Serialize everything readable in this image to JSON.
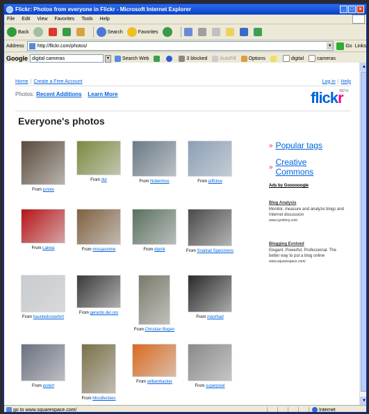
{
  "window": {
    "title": "Flickr: Photos from everyone in Flickr - Microsoft Internet Explorer",
    "controls": [
      "_",
      "□",
      "×"
    ]
  },
  "menu": [
    "File",
    "Edit",
    "View",
    "Favorites",
    "Tools",
    "Help"
  ],
  "toolbar": {
    "back": "Back",
    "search": "Search",
    "favorites": "Favorites"
  },
  "address": {
    "label": "Address",
    "url": "http://flickr.com/photos/",
    "go": "Go",
    "links": "Links"
  },
  "google_toolbar": {
    "logo": "Google",
    "query": "digital cameras",
    "search_web": "Search Web",
    "blocked": "3 blocked",
    "autofill": "AutoFill",
    "options": "Options",
    "term1": "digital",
    "term2": "cameras"
  },
  "page": {
    "nav": {
      "home": "Home",
      "create": "Create a Free Account",
      "login": "Log in",
      "help": "Help",
      "sep": "|"
    },
    "photos_label": "Photos:",
    "recent": "Recent Additions",
    "dot": "·",
    "learn": "Learn More",
    "logo_fl": "flick",
    "logo_r": "r",
    "beta": "BETA",
    "heading": "Everyone's photos",
    "from": "From",
    "photos": [
      {
        "user": "junnie",
        "color": "#5a4a3a",
        "w": 64,
        "h": 64
      },
      {
        "user": "dvt",
        "color": "#7a8a3e",
        "w": 64,
        "h": 50
      },
      {
        "user": "Nobermus",
        "color": "#6a7a86",
        "w": 64,
        "h": 52
      },
      {
        "user": "jeffclow",
        "color": "#8aa0b8",
        "w": 64,
        "h": 52
      },
      {
        "user": "Lakwa",
        "color": "#b81418",
        "w": 64,
        "h": 50
      },
      {
        "user": "missjasmine",
        "color": "#806040",
        "w": 64,
        "h": 52
      },
      {
        "user": "dipnik",
        "color": "#5a7060",
        "w": 64,
        "h": 52
      },
      {
        "user": "Snailrail Specimens",
        "color": "#4a4a4a",
        "w": 64,
        "h": 54
      },
      {
        "user": "hauntedsnowfort",
        "color": "#c8ccd0",
        "w": 64,
        "h": 54
      },
      {
        "user": "gerardo del oro",
        "color": "#3a3a3a",
        "w": 64,
        "h": 48
      },
      {
        "user": "Christian Bogen",
        "color": "#7a7a6a",
        "w": 46,
        "h": 72
      },
      {
        "user": "maorhad",
        "color": "#2a2a2a",
        "w": 64,
        "h": 54
      },
      {
        "user": "eistert",
        "color": "#6a7080",
        "w": 64,
        "h": 54
      },
      {
        "user": "MissBeckies",
        "color": "#7a7048",
        "w": 50,
        "h": 72
      },
      {
        "user": "williamhacker",
        "color": "#d86a20",
        "w": 64,
        "h": 48
      },
      {
        "user": "superpixel",
        "color": "#8a8a8a",
        "w": 64,
        "h": 54
      }
    ],
    "side": {
      "popular": "Popular tags",
      "cc": "Creative Commons",
      "ads_by": "Ads by Goooooogle",
      "ad1_title": "Blog Analysis",
      "ad1_text": "Monitor, measure and analyze blogs and Internet discussion",
      "ad1_url": "www.symfony.com",
      "ad2_title": "Blogging Evolved",
      "ad2_text": "Elegant. Powerful. Professional. The better way to put a blog online",
      "ad2_url": "www.squarespace.com/"
    }
  },
  "status": {
    "text": "go to www.squarespace.com/",
    "zone": "Internet"
  }
}
